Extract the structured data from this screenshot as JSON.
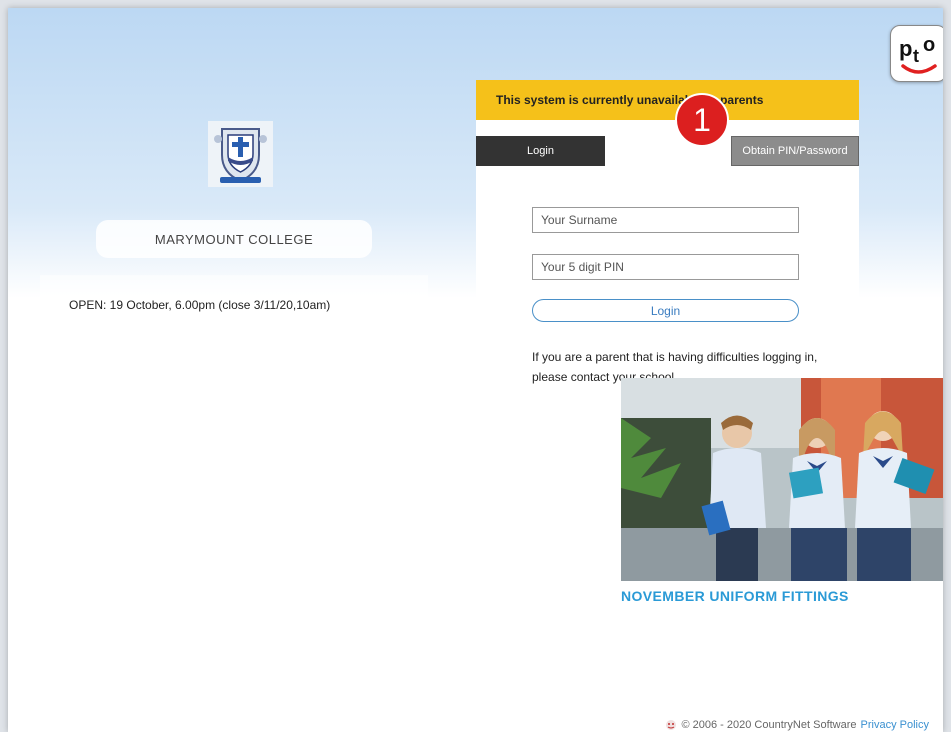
{
  "branding": {
    "logo_text": "pto",
    "school_name": "MARYMOUNT COLLEGE"
  },
  "announcement": "OPEN: 19 October, 6.00pm (close 3/11/20,10am)",
  "panel": {
    "notice": "This system is currently unavailable to parents",
    "tabs": [
      {
        "label": "Login"
      },
      {
        "label": "Obtain PIN/Password"
      }
    ],
    "surname_placeholder": "Your Surname",
    "pin_placeholder": "Your 5 digit PIN",
    "login_button": "Login",
    "help_text": "If you are a parent that is having difficulties logging in, please contact your school."
  },
  "annotation_badge": "1",
  "promo": {
    "caption": "NOVEMBER UNIFORM FITTINGS"
  },
  "footer": {
    "copyright": "© 2006 - 2020 CountryNet Software",
    "privacy_link": "Privacy Policy"
  },
  "colors": {
    "notice_bg": "#f5c11a",
    "tab_active": "#333333",
    "tab_inactive": "#8c8c8c",
    "accent": "#2a9ad6",
    "badge": "#dc1f1f"
  },
  "icons": [
    "pto-logo-icon",
    "school-crest-icon",
    "countrynet-icon"
  ]
}
